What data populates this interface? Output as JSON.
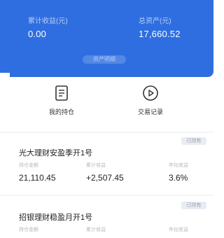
{
  "summary": {
    "left_label": "累计收益(元)",
    "left_value": "0.00",
    "right_label": "总资产(元)",
    "right_value": "17,660.52",
    "link_label": "资产明细"
  },
  "actions": [
    {
      "label": "我的持仓",
      "icon": "document-list-icon"
    },
    {
      "label": "交易记录",
      "icon": "play-circle-icon"
    }
  ],
  "plans": [
    {
      "tag": "已持有",
      "title": "光大理财安盈季开1号",
      "col_labels": [
        "持仓金额",
        "累计收益",
        "年化收益"
      ],
      "values": [
        "21,110.45",
        "+2,507.45",
        "3.6%"
      ]
    },
    {
      "tag": "已持有",
      "title": "招银理财稳盈月开1号",
      "col_labels": [
        "持仓金额",
        "累计收益",
        "年化收益"
      ],
      "values": [
        "",
        "",
        ""
      ]
    }
  ],
  "colors": {
    "accent": "#2f6ee0"
  }
}
